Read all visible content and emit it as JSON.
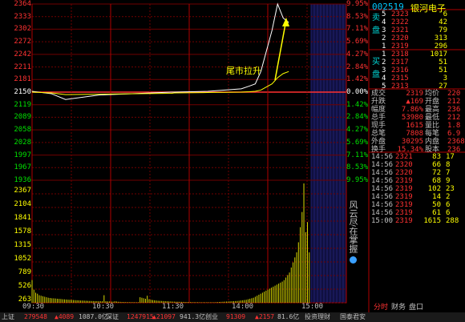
{
  "stock": {
    "code": "002519",
    "name": "银河电子"
  },
  "annotation": "尾市拉升",
  "price_axis": [
    "2364",
    "2333",
    "2302",
    "2272",
    "2242",
    "2211",
    "2181",
    "2150",
    "2119",
    "2089",
    "2058",
    "2028",
    "1997",
    "1967",
    "1936"
  ],
  "pct_axis": [
    "9.95%",
    "8.53%",
    "7.11%",
    "5.69%",
    "4.27%",
    "2.84%",
    "1.42%",
    "0.00%",
    "1.42%",
    "2.84%",
    "4.27%",
    "5.69%",
    "7.11%",
    "8.53%",
    "9.95%"
  ],
  "vol_axis": [
    "2367",
    "2104",
    "1841",
    "1578",
    "1315",
    "1052",
    "789",
    "526",
    "263"
  ],
  "time_axis": [
    "09:30",
    "10:30",
    "11:30",
    "14:00",
    "15:00"
  ],
  "side_badge": "风云尽在掌握",
  "sell_label": "卖 盘",
  "buy_label": "买 盘",
  "sell_orders": [
    {
      "lvl": "5",
      "price": "2323",
      "vol": "6"
    },
    {
      "lvl": "4",
      "price": "2322",
      "vol": "42"
    },
    {
      "lvl": "3",
      "price": "2321",
      "vol": "79"
    },
    {
      "lvl": "2",
      "price": "2320",
      "vol": "313"
    },
    {
      "lvl": "1",
      "price": "2319",
      "vol": "296"
    }
  ],
  "buy_orders": [
    {
      "lvl": "1",
      "price": "2318",
      "vol": "1017"
    },
    {
      "lvl": "2",
      "price": "2317",
      "vol": "51"
    },
    {
      "lvl": "3",
      "price": "2316",
      "vol": "51"
    },
    {
      "lvl": "4",
      "price": "2315",
      "vol": "3"
    },
    {
      "lvl": "5",
      "price": "2313",
      "vol": "27"
    }
  ],
  "quote": [
    {
      "k1": "成交",
      "v1": "2319",
      "k2": "均价",
      "v2": "220"
    },
    {
      "k1": "升跌",
      "v1": "▲169",
      "k2": "开盘",
      "v2": "212"
    },
    {
      "k1": "幅度",
      "v1": "7.86%",
      "k2": "最高",
      "v2": "236"
    },
    {
      "k1": "总手",
      "v1": "53980",
      "k2": "最低",
      "v2": "212"
    },
    {
      "k1": "现手",
      "v1": "1615",
      "k2": "量比",
      "v2": "1.8"
    },
    {
      "k1": "总笔",
      "v1": "7808",
      "k2": "每笔",
      "v2": "6.9"
    },
    {
      "k1": "外盘",
      "v1": "30295",
      "k2": "内盘",
      "v2": "2368"
    },
    {
      "k1": "换手",
      "v1": "15.34%",
      "k2": "股本",
      "v2": "236"
    }
  ],
  "ticks": [
    {
      "time": "14:56",
      "price": "2321",
      "vol": "83",
      "n": "17"
    },
    {
      "time": "14:56",
      "price": "2320",
      "vol": "66",
      "n": "8"
    },
    {
      "time": "14:56",
      "price": "2320",
      "vol": "72",
      "n": "7"
    },
    {
      "time": "14:56",
      "price": "2319",
      "vol": "68",
      "n": "9"
    },
    {
      "time": "14:56",
      "price": "2319",
      "vol": "102",
      "n": "23"
    },
    {
      "time": "14:56",
      "price": "2319",
      "vol": "14",
      "n": "2"
    },
    {
      "time": "14:56",
      "price": "2319",
      "vol": "50",
      "n": "6"
    },
    {
      "time": "14:56",
      "price": "2319",
      "vol": "61",
      "n": "6"
    },
    {
      "time": "15:00",
      "price": "2319",
      "vol": "1615",
      "n": "288"
    }
  ],
  "bottom_tabs": [
    "分时",
    "财务",
    "盘口"
  ],
  "statusbar": [
    {
      "text": "上证",
      "color": "#c0c0c0"
    },
    {
      "text": "279548",
      "color": "#ff3232"
    },
    {
      "text": "▲4089",
      "color": "#ff3232"
    },
    {
      "text": "1087.0亿",
      "color": "#c0c0c0"
    },
    {
      "text": "深证",
      "color": "#c0c0c0"
    },
    {
      "text": "1247915",
      "color": "#ff3232"
    },
    {
      "text": "▲21097",
      "color": "#ff3232"
    },
    {
      "text": "941.3亿",
      "color": "#c0c0c0"
    },
    {
      "text": "创业",
      "color": "#c0c0c0"
    },
    {
      "text": "91309",
      "color": "#ff3232"
    },
    {
      "text": "▲2157",
      "color": "#ff3232"
    },
    {
      "text": "81.6亿",
      "color": "#c0c0c0"
    },
    {
      "text": "投资理财",
      "color": "#c0c0c0"
    },
    {
      "text": "国泰君安",
      "color": "#c0c0c0"
    }
  ],
  "chart_data": {
    "type": "line",
    "title": "",
    "xlabel": "",
    "ylabel": "",
    "prev_close": 2150,
    "ylim": [
      1936,
      2364
    ],
    "x": [
      "09:30",
      "10:00",
      "10:30",
      "11:00",
      "11:30",
      "13:30",
      "14:00",
      "14:30",
      "14:40",
      "14:45",
      "14:50",
      "14:53",
      "14:55",
      "14:57",
      "15:00"
    ],
    "series": [
      {
        "color": "#ffffff",
        "values": [
          2152,
          2146,
          2132,
          2143,
          2150,
          2150,
          2152,
          2158,
          2165,
          2170,
          2200,
          2300,
          2364,
          2330,
          2319
        ]
      },
      {
        "color": "#ffff00",
        "values": [
          2150,
          2148,
          2144,
          2145,
          2147,
          2148,
          2149,
          2150,
          2151,
          2152,
          2155,
          2170,
          2185,
          2195,
          2200
        ]
      }
    ],
    "volume": {
      "ylim": [
        0,
        2367
      ],
      "values": [
        450,
        260,
        200,
        180,
        150,
        140,
        130,
        120,
        110,
        100,
        95,
        90,
        88,
        85,
        80,
        78,
        75,
        70,
        68,
        65,
        62,
        60,
        58,
        55,
        52,
        50,
        48,
        45,
        44,
        42,
        40,
        38,
        36,
        35,
        34,
        33,
        32,
        31,
        30,
        30,
        150,
        30,
        28,
        26,
        24,
        22,
        30,
        25,
        20,
        18,
        16,
        15,
        14,
        13,
        13,
        12,
        12,
        12,
        11,
        11,
        110,
        100,
        90,
        80,
        140,
        70,
        60,
        55,
        50,
        45,
        40,
        38,
        36,
        34,
        32,
        30,
        28,
        26,
        24,
        22,
        20,
        20,
        19,
        18,
        17,
        16,
        15,
        14,
        13,
        12,
        12,
        11,
        11,
        10,
        10,
        10,
        10,
        10,
        10,
        10,
        10,
        10,
        12,
        14,
        16,
        18,
        20,
        22,
        24,
        26,
        28,
        30,
        32,
        34,
        36,
        40,
        45,
        50,
        55,
        60,
        70,
        80,
        90,
        100,
        120,
        140,
        160,
        180,
        200,
        220,
        240,
        260,
        280,
        300,
        320,
        340,
        360,
        380,
        400,
        420,
        450,
        500,
        550,
        600,
        700,
        800,
        900,
        1000,
        1200,
        1500,
        1800,
        2367,
        1400,
        1600,
        1000
      ]
    }
  }
}
